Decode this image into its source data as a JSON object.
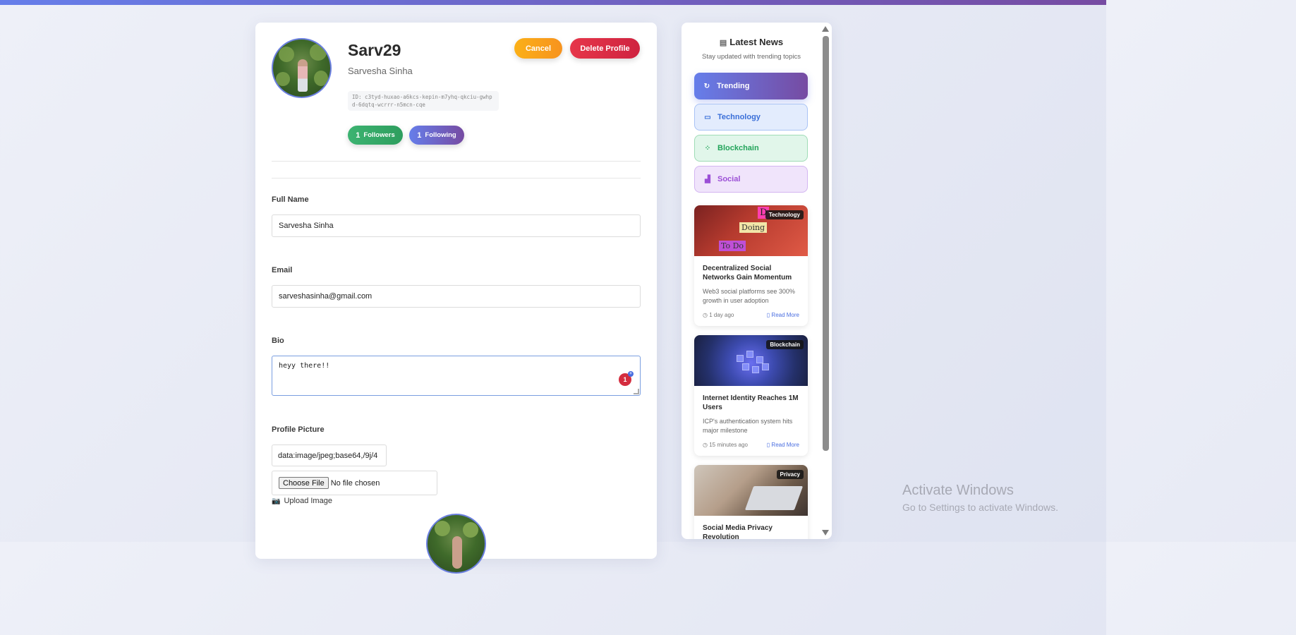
{
  "profile": {
    "username": "Sarv29",
    "display_name": "Sarvesha Sinha",
    "user_id": "ID: c3tyd-huxao-a6kcs-kepin-m7yhq-qkciu-gwhpd-6dqtq-wcrrr-n5mcn-cqe",
    "followers_count": "1",
    "followers_label": "Followers",
    "following_count": "1",
    "following_label": "Following"
  },
  "actions": {
    "cancel_label": "Cancel",
    "delete_label": "Delete Profile"
  },
  "form": {
    "full_name_label": "Full Name",
    "full_name_value": "Sarvesha Sinha",
    "email_label": "Email",
    "email_value": "sarveshasinha@gmail.com",
    "bio_label": "Bio",
    "bio_value": "heyy there!!",
    "picture_label": "Profile Picture",
    "picture_url_value": "data:image/jpeg;base64,/9j/4",
    "choose_file_label": "Choose File",
    "file_status": "No file chosen",
    "upload_label": "Upload Image",
    "grammar_count": "1"
  },
  "news": {
    "title": "Latest News",
    "subtitle": "Stay updated with trending topics",
    "categories": [
      {
        "label": "Trending",
        "icon": "refresh-icon"
      },
      {
        "label": "Technology",
        "icon": "monitor-icon"
      },
      {
        "label": "Blockchain",
        "icon": "nodes-icon"
      },
      {
        "label": "Social",
        "icon": "chart-icon"
      }
    ],
    "articles": [
      {
        "tag": "Technology",
        "title": "Decentralized Social Networks Gain Momentum",
        "desc": "Web3 social platforms see 300% growth in user adoption",
        "time": "1 day ago",
        "read": "Read More"
      },
      {
        "tag": "Blockchain",
        "title": "Internet Identity Reaches 1M Users",
        "desc": "ICP's authentication system hits major milestone",
        "time": "15 minutes ago",
        "read": "Read More"
      },
      {
        "tag": "Privacy",
        "title": "Social Media Privacy Revolution",
        "desc": "",
        "time": "",
        "read": ""
      }
    ],
    "tech_image_notes": [
      "Doing",
      "To Do",
      "D"
    ]
  },
  "watermark": {
    "title": "Activate Windows",
    "subtitle": "Go to Settings to activate Windows."
  },
  "colors": {
    "accent": "#667eea",
    "accent_dark": "#764ba2",
    "followers_green": "#3cb371",
    "cancel_orange": "#f7931e",
    "delete_red": "#cf2340"
  }
}
